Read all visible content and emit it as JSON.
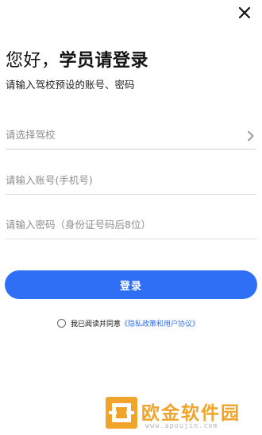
{
  "header": {
    "greeting": "您好，",
    "title": "学员请登录",
    "subtitle": "请输入驾校预设的账号、密码"
  },
  "form": {
    "school_placeholder": "请选择驾校",
    "account_placeholder": "请输入账号(手机号)",
    "password_placeholder": "请输入密码（身份证号码后8位）",
    "login_label": "登录"
  },
  "agreement": {
    "prefix": "我已阅读并同意",
    "policy_link": "《隐私政策和用户协议》"
  },
  "watermark": {
    "text": "欧金软件园",
    "url": "www.apoujin.com"
  },
  "icons": {
    "close": "close-icon",
    "chevron": "chevron-right-icon",
    "radio": "radio-unchecked-icon"
  },
  "colors": {
    "accent": "#2f6ff5",
    "watermark": "#f0a52a"
  }
}
